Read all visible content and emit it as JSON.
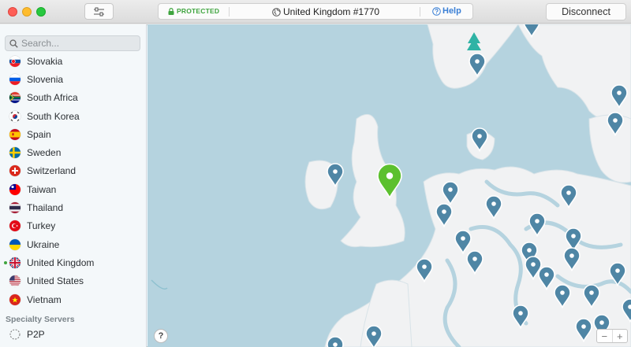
{
  "titlebar": {
    "status": "PROTECTED",
    "server": "United Kingdom #1770",
    "help": "Help",
    "disconnect": "Disconnect"
  },
  "sidebar": {
    "search_placeholder": "Search...",
    "countries": [
      {
        "name": "Slovakia",
        "flag": "slovakia"
      },
      {
        "name": "Slovenia",
        "flag": "slovenia"
      },
      {
        "name": "South Africa",
        "flag": "south-africa"
      },
      {
        "name": "South Korea",
        "flag": "south-korea"
      },
      {
        "name": "Spain",
        "flag": "spain"
      },
      {
        "name": "Sweden",
        "flag": "sweden"
      },
      {
        "name": "Switzerland",
        "flag": "switzerland"
      },
      {
        "name": "Taiwan",
        "flag": "taiwan"
      },
      {
        "name": "Thailand",
        "flag": "thailand"
      },
      {
        "name": "Turkey",
        "flag": "turkey"
      },
      {
        "name": "Ukraine",
        "flag": "ukraine"
      },
      {
        "name": "United Kingdom",
        "flag": "united-kingdom",
        "connected": true
      },
      {
        "name": "United States",
        "flag": "united-states"
      },
      {
        "name": "Vietnam",
        "flag": "vietnam"
      }
    ],
    "specialty_title": "Specialty Servers",
    "specialty": [
      {
        "name": "P2P",
        "icon": "p2p-icon"
      }
    ]
  },
  "map": {
    "help": "?",
    "zoom_out": "−",
    "zoom_in": "+",
    "colors": {
      "water": "#b5d3df",
      "land": "#f1f2f3",
      "pin": "#4f86a5",
      "active_pin": "#5cc02e",
      "tree": "#2fb3a5"
    }
  }
}
